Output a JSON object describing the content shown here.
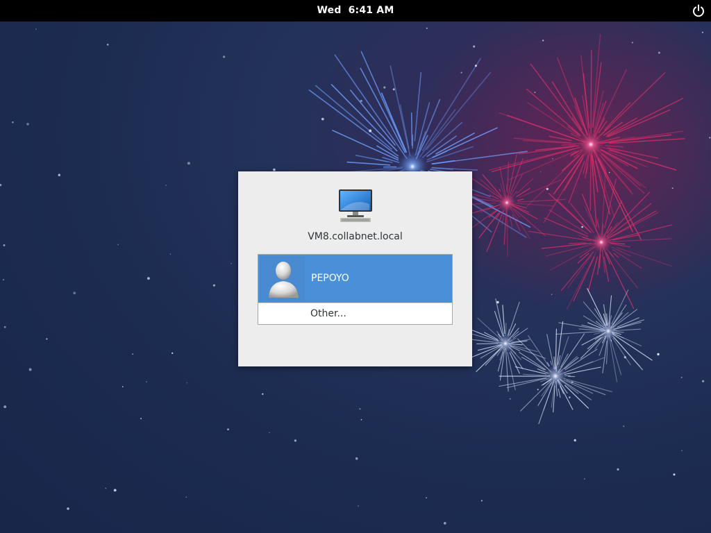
{
  "topbar": {
    "day": "Wed",
    "time": "6:41 AM",
    "power_icon": "power-icon"
  },
  "login": {
    "computer_icon": "computer-icon",
    "hostname": "VM8.collabnet.local",
    "users": [
      {
        "name": "PEPOYO",
        "avatar_icon": "user-avatar-icon",
        "selected": true
      }
    ],
    "other_label": "Other..."
  },
  "colors": {
    "topbar_bg": "#000000",
    "dialog_bg": "#ededed",
    "selection": "#4a90d9",
    "wallpaper_base": "#1c2b50",
    "firework_blue": "#6fa0ff",
    "firework_pink": "#e0306a",
    "firework_white": "#dfe8ff"
  }
}
